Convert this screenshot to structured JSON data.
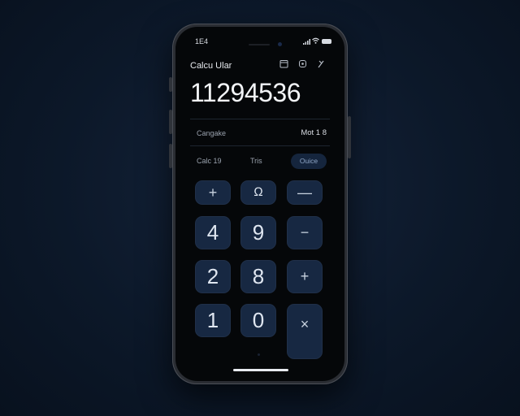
{
  "status": {
    "time": "1E4",
    "signal_icon": "signal-icon",
    "wifi_icon": "wifi-icon",
    "battery_icon": "battery-icon"
  },
  "header": {
    "title": "Calcu Ular",
    "icons": [
      "calendar-icon",
      "history-icon",
      "settings-icon"
    ]
  },
  "display": {
    "value": "11294536"
  },
  "info": {
    "label": "Cangake",
    "value": "Mot 1 8"
  },
  "modes": {
    "left": "Calc 19",
    "middle": "Tris",
    "active": "Ouice"
  },
  "keys": {
    "plus_top": "+",
    "paren": "Ω",
    "minus_top": "—",
    "k4": "4",
    "k9": "9",
    "minus": "−",
    "k2": "2",
    "k8": "8",
    "plus": "+",
    "k1": "1",
    "k0": "0",
    "multiply": "×"
  },
  "colors": {
    "background": "#0c1829",
    "key": "#172842",
    "chip": "#15253d"
  }
}
